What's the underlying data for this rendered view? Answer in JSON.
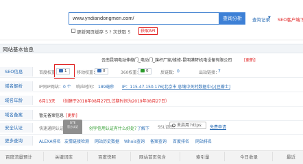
{
  "search": {
    "value": "www.yndiandongmen.com/",
    "button": "查询分析",
    "history": "查询记录",
    "history_arrow": "▼",
    "seo_link": "SEO客户端下",
    "update_label": "更新网页缓存 5 ? 次获取 5",
    "api_label": "获取API"
  },
  "info_title": "网站基本信息",
  "rows": {
    "seo": "SEO信息",
    "whois": "域名解析",
    "age": "域名年龄",
    "record": "域名备案",
    "security": "安全认证",
    "more": "更多查询"
  },
  "company": {
    "name": "云南昆明电动伸缩门_电动门_旗杆厂家/维修-昆明港轩机电设备有限公司",
    "more": "[更新]"
  },
  "seo": {
    "pc_label": "百度权重：",
    "pc_value": "1",
    "mobile_label": "移动权重：",
    "mobile_value": "0",
    "so_label": "360权重：",
    "so_value": "0",
    "sogou_label": "反链数：",
    "sogou_value": "0",
    "out_label": "出站链接：",
    "out_value": "7"
  },
  "whois": {
    "ip_label": "IP同IP网站：",
    "ip_count": "0 个",
    "speed_label": "响应时间：",
    "speed_value": "189毫秒",
    "ip_value": "IP：115.47.150.176[北京市 息壤中关村数据中心[豆瓣士]"
  },
  "age": {
    "value": "6月13天",
    "detail": "（创建于2018年08月27日,过期时间为2019年08月27日）"
  },
  "record": {
    "value": "暂无备案信息",
    "more": "[更新]"
  },
  "security": {
    "seal_line1": "SiTE",
    "seal_line2": "官方认证",
    "query": "快速通网认证",
    "trust_text": "创宇信用认证有什么好处？",
    "learn": "了解下",
    "ssl_label": "SSL证书：",
    "ssl_value": "未启用 https:",
    "free_ssl": "免费申请"
  },
  "more_queries": [
    "ALEXA排名",
    "友情链接检测",
    "网站历史数据",
    "Whois查询",
    "备案查询",
    "百度排名",
    "网站排名"
  ],
  "tabs": [
    "百度流量预计",
    "关键词库",
    "百度快照",
    "网站首页包含",
    "索引量",
    "今日收录",
    "最近"
  ],
  "colors": {
    "accent": "#3d80d6",
    "link": "#2a6db5",
    "alert": "#e02020"
  }
}
